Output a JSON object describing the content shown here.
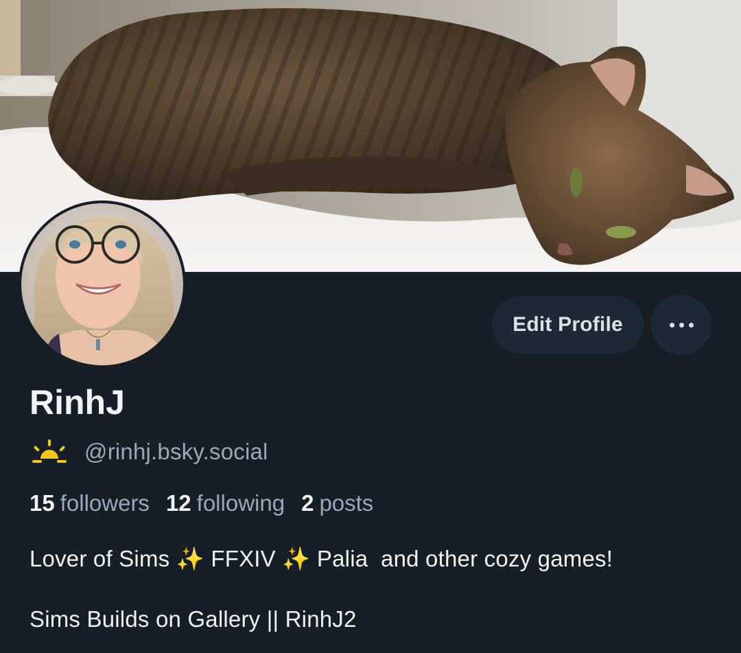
{
  "profile": {
    "display_name": "RinhJ",
    "handle": "@rinhj.bsky.social",
    "handle_icon": "sunrise-icon",
    "stats": {
      "followers_count": "15",
      "followers_label": "followers",
      "following_count": "12",
      "following_label": "following",
      "posts_count": "2",
      "posts_label": "posts"
    },
    "bio": {
      "line1": "Lover of Sims ✨ FFXIV ✨ Palia  and other cozy games!",
      "line2": "Sims Builds on Gallery || RinhJ2"
    }
  },
  "actions": {
    "edit_label": "Edit Profile",
    "more_icon": "more-options-icon"
  },
  "colors": {
    "background": "#161e27",
    "button_bg": "#1e2936",
    "primary_text": "#f1f3f5",
    "secondary_text": "#9aa8b7",
    "icon_yellow": "#f5c518"
  }
}
